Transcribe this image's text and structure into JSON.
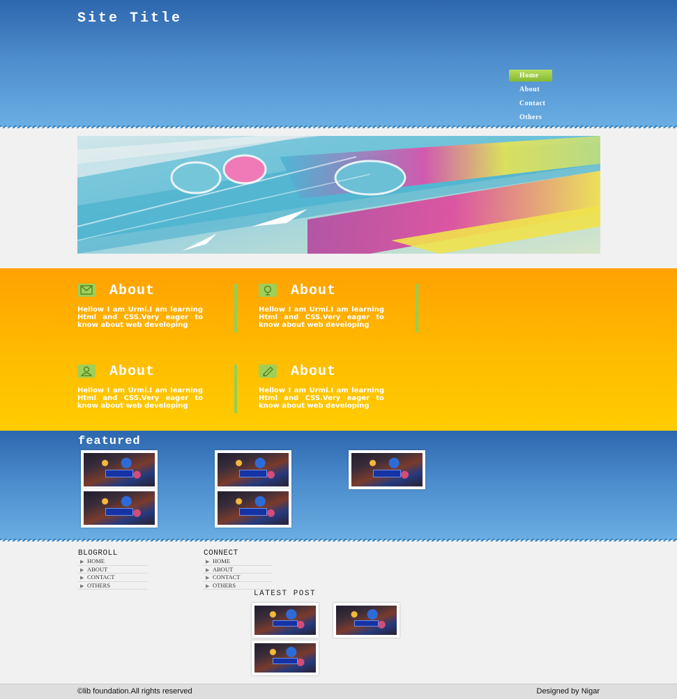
{
  "header": {
    "site_title": "Site Title",
    "nav": [
      "Home",
      "About",
      "Contact",
      "Others"
    ]
  },
  "banner": {
    "image": "colorful abstract ribbons banner"
  },
  "about": {
    "items": [
      {
        "icon": "mail-icon",
        "title": "About",
        "text": "Hellow I am Urmi.I am learning Html and CSS.Very eager to know about web developing"
      },
      {
        "icon": "lightbulb-icon",
        "title": "About",
        "text": "Hellow I am Urmi.I am learning Html and CSS.Very eager to know about web developing"
      },
      {
        "icon": "user-icon",
        "title": "About",
        "text": "Hellow I am Urmi.I am learning Html and CSS.Very eager to know about web developing"
      },
      {
        "icon": "pencil-icon",
        "title": "About",
        "text": "Hellow I am Urmi.I am learning Html and CSS.Very eager to know about web developing"
      }
    ]
  },
  "featured": {
    "title": "featured"
  },
  "footer": {
    "blogroll": {
      "title": "BLOGROLL",
      "links": [
        "HOME",
        "ABOUT",
        "CONTACT",
        "OTHERS"
      ]
    },
    "connect": {
      "title": "CONNECT",
      "links": [
        "HOME",
        "ABOUT",
        "CONTACT",
        "OTHERS"
      ]
    },
    "latest_post": {
      "title": "LATEST POST"
    },
    "copyright": "©lib foundation.All rights reserved",
    "designer": "Designed by Nigar"
  },
  "colors": {
    "header_blue": "#2d66ad",
    "light_blue": "#6aaee3",
    "orange": "#ffa102",
    "yellow": "#ffcc00",
    "green_accent": "#93cf56"
  }
}
